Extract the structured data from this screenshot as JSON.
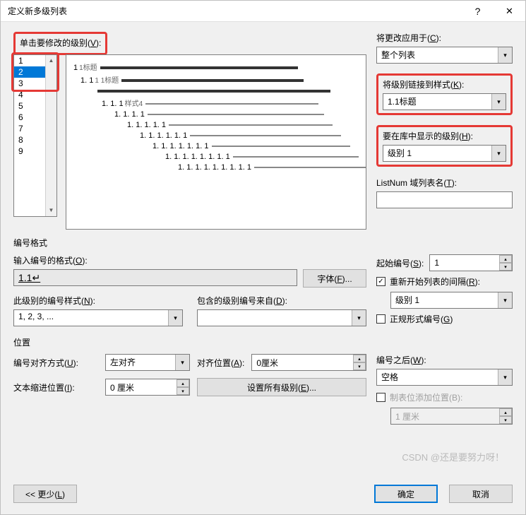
{
  "titlebar": {
    "title": "定义新多级列表",
    "help": "?",
    "close": "✕"
  },
  "left": {
    "click_level_label_pre": "单击要修改的级别(",
    "click_level_key": "V",
    "click_level_label_post": "):",
    "levels": [
      "1",
      "2",
      "3",
      "4",
      "5",
      "6",
      "7",
      "8",
      "9"
    ],
    "selected_level": "2",
    "preview": [
      {
        "indent": 0,
        "num": "1",
        "note": "1标题",
        "fill": 280,
        "strong": true
      },
      {
        "indent": 10,
        "num": "1. 1",
        "note": "1 1标题",
        "fill": 258,
        "strong": true
      },
      {
        "indent": 30,
        "num": "",
        "note": "",
        "fill": 330,
        "strong": true
      },
      {
        "indent": 40,
        "num": "1. 1. 1",
        "note": "样式4",
        "fill": 245,
        "strong": false
      },
      {
        "indent": 58,
        "num": "1. 1. 1. 1",
        "note": "",
        "fill": 250,
        "strong": false
      },
      {
        "indent": 76,
        "num": "1. 1. 1. 1. 1",
        "note": "",
        "fill": 232,
        "strong": false
      },
      {
        "indent": 94,
        "num": "1. 1. 1. 1. 1. 1",
        "note": "",
        "fill": 214,
        "strong": false
      },
      {
        "indent": 112,
        "num": "1. 1. 1. 1. 1. 1. 1",
        "note": "",
        "fill": 196,
        "strong": false
      },
      {
        "indent": 130,
        "num": "1. 1. 1. 1. 1. 1. 1. 1",
        "note": "",
        "fill": 178,
        "strong": false
      },
      {
        "indent": 148,
        "num": "1. 1. 1. 1. 1. 1. 1. 1. 1",
        "note": "",
        "fill": 160,
        "strong": false
      }
    ]
  },
  "right": {
    "apply_to_label_pre": "将更改应用于(",
    "apply_to_key": "C",
    "apply_to_label_post": "):",
    "apply_to_value": "整个列表",
    "link_style_label_pre": "将级别链接到样式(",
    "link_style_key": "K",
    "link_style_label_post": "):",
    "link_style_value": "1.1标题",
    "show_in_gallery_label_pre": "要在库中显示的级别(",
    "show_in_gallery_key": "H",
    "show_in_gallery_label_post": "):",
    "show_in_gallery_value": "级别 1",
    "listnum_label_pre": "ListNum 域列表名(",
    "listnum_key": "T",
    "listnum_label_post": "):",
    "listnum_value": ""
  },
  "numfmt": {
    "section_label": "编号格式",
    "enter_format_label_pre": "输入编号的格式(",
    "enter_format_key": "O",
    "enter_format_label_post": "):",
    "enter_format_value": "1.1↵",
    "font_btn_pre": "字体(",
    "font_btn_key": "F",
    "font_btn_post": ")...",
    "number_style_label_pre": "此级别的编号样式(",
    "number_style_key": "N",
    "number_style_label_post": "):",
    "number_style_value": "1, 2, 3, ...",
    "include_from_label_pre": "包含的级别编号来自(",
    "include_from_key": "D",
    "include_from_label_post": "):",
    "include_from_value": "",
    "start_at_label_pre": "起始编号(",
    "start_at_key": "S",
    "start_at_label_post": "):",
    "start_at_value": "1",
    "restart_label_pre": "重新开始列表的间隔(",
    "restart_key": "R",
    "restart_label_post": "):",
    "restart_checked": true,
    "restart_value": "级别 1",
    "legal_label_pre": "正规形式编号(",
    "legal_key": "G",
    "legal_label_post": ")",
    "legal_checked": false
  },
  "position": {
    "section_label": "位置",
    "align_label_pre": "编号对齐方式(",
    "align_key": "U",
    "align_label_post": "):",
    "align_value": "左对齐",
    "align_at_label_pre": "对齐位置(",
    "align_at_key": "A",
    "align_at_label_post": "):",
    "align_at_value": "0厘米",
    "indent_label_pre": "文本缩进位置(",
    "indent_key": "I",
    "indent_label_post": "):",
    "indent_value": "0 厘米",
    "set_all_btn_pre": "设置所有级别(",
    "set_all_key": "E",
    "set_all_btn_post": ")...",
    "follow_label_pre": "编号之后(",
    "follow_key": "W",
    "follow_label_post": "):",
    "follow_value": "空格",
    "tab_add_label_pre": "制表位添加位置(",
    "tab_add_key": "B",
    "tab_add_label_post": "):",
    "tab_add_checked": false,
    "tab_add_value": "1 厘米"
  },
  "buttons": {
    "less_pre": "<< 更少(",
    "less_key": "L",
    "less_post": ")",
    "ok": "确定",
    "cancel": "取消"
  },
  "watermark": "CSDN @还是要努力呀！"
}
